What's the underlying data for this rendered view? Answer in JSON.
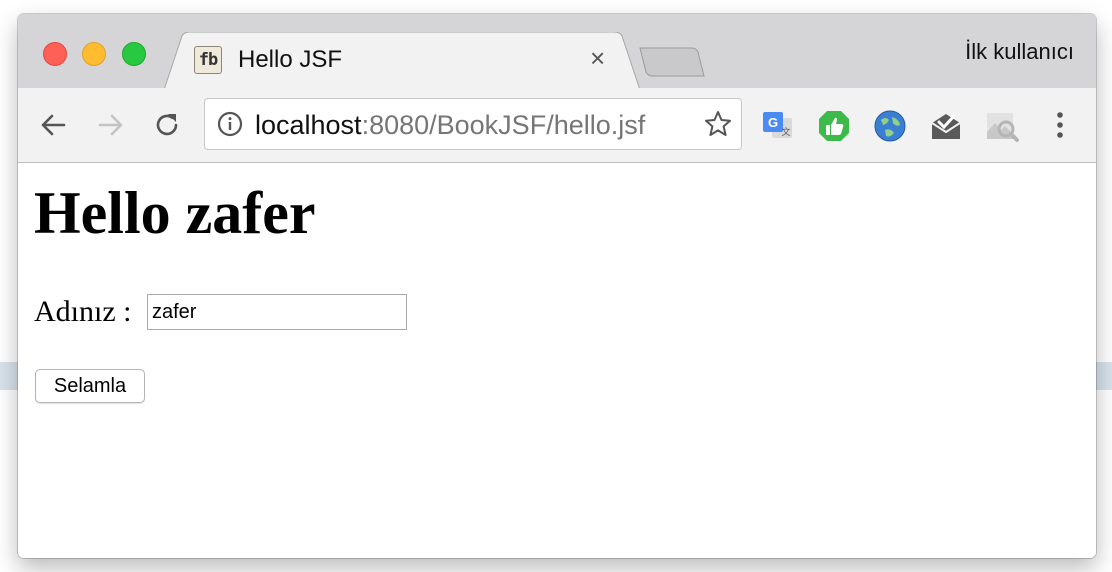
{
  "browser": {
    "tab_title": "Hello JSF",
    "favicon_text": "fb",
    "tab_close": "×",
    "profile_name": "İlk kullanıcı",
    "url_host": "localhost",
    "url_rest": ":8080/BookJSF/hello.jsf",
    "icons": {
      "back": "arrow-left-icon",
      "forward": "arrow-right-icon",
      "reload": "reload-icon",
      "info": "info-icon",
      "bookmark": "star-icon",
      "extensions": [
        "google-translate-icon",
        "thumbs-up-icon",
        "globe-icon",
        "mail-check-icon",
        "image-search-icon"
      ],
      "menu": "more-vertical-icon"
    }
  },
  "page": {
    "heading": "Hello zafer",
    "name_label": "Adınız :",
    "name_value": "zafer",
    "submit_label": "Selamla"
  },
  "colors": {
    "tabstrip": "#d5d5d8",
    "toolbar": "#f2f2f2",
    "close_red": "#fe5f57",
    "minimize_yellow": "#febc2e",
    "zoom_green": "#28c840"
  }
}
